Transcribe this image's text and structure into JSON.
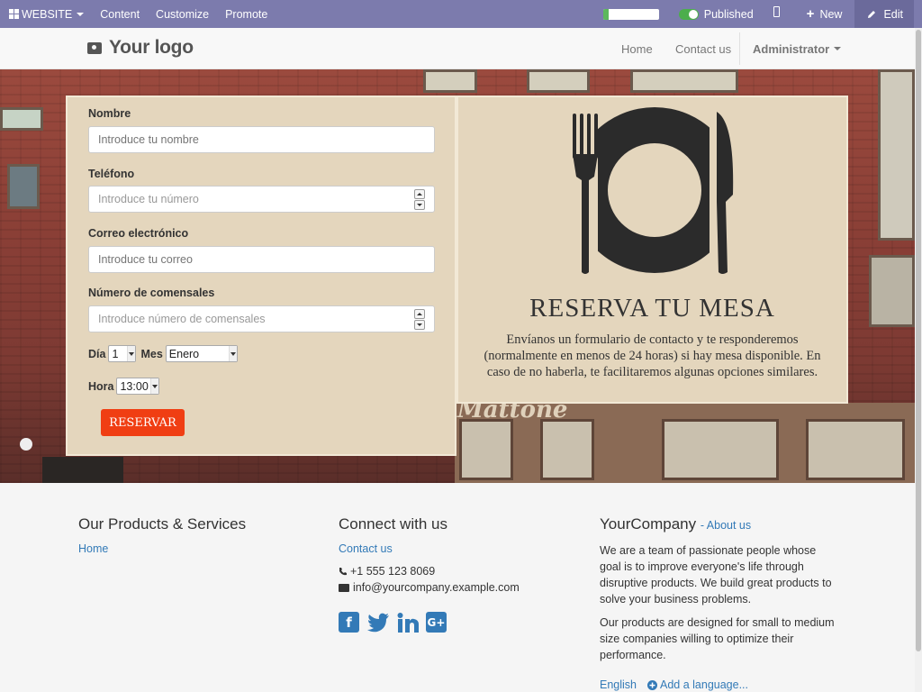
{
  "adminbar": {
    "website_label": "WEBSITE",
    "menu": [
      "Content",
      "Customize",
      "Promote"
    ],
    "progress": 0.1,
    "published_label": "Published",
    "new_label": "New",
    "edit_label": "Edit",
    "colors": {
      "bar": "#7c7bad",
      "edit_bg": "#6b6a9b",
      "toggle": "#4cae4c"
    }
  },
  "header": {
    "logo_text": "Your logo",
    "nav": {
      "home": "Home",
      "contact": "Contact us",
      "user": "Administrator"
    }
  },
  "form": {
    "name_label": "Nombre",
    "name_placeholder": "Introduce tu nombre",
    "phone_label": "Teléfono",
    "phone_placeholder": "Introduce tu número",
    "email_label": "Correo electrónico",
    "email_placeholder": "Introduce tu correo",
    "guests_label": "Número de comensales",
    "guests_placeholder": "Introduce número de comensales",
    "day_label": "Día",
    "day_value": "1",
    "month_label": "Mes",
    "month_value": "Enero",
    "hour_label": "Hora",
    "hour_value": "13:00",
    "submit_label": "RESERVAR",
    "colors": {
      "panel": "#e4d6bd",
      "submit": "#f03e13"
    }
  },
  "info": {
    "icon": "plate-fork-knife-icon",
    "title": "RESERVA TU MESA",
    "text": "Envíanos un formulario de contacto y te responderemos (normalmente en menos de 24 horas) si hay mesa disponible. En caso de no haberla, te facilitaremos algunas opciones similares."
  },
  "hero": {
    "sign_text": "Mattone"
  },
  "footer": {
    "products": {
      "title": "Our Products & Services",
      "links": [
        "Home"
      ]
    },
    "connect": {
      "title": "Connect with us",
      "contact_link": "Contact us",
      "phone": "+1 555 123 8069",
      "email": "info@yourcompany.example.com",
      "social_icons": [
        "facebook-icon",
        "twitter-icon",
        "linkedin-icon",
        "google-plus-icon"
      ]
    },
    "company": {
      "title": "YourCompany",
      "about_link": "- About us",
      "p1": "We are a team of passionate people whose goal is to improve everyone's life through disruptive products. We build great products to solve your business problems.",
      "p2": "Our products are designed for small to medium size companies willing to optimize their performance.",
      "language": "English",
      "add_language": "Add a language..."
    }
  }
}
